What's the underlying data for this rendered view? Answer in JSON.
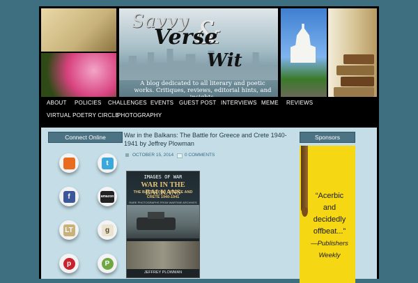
{
  "header": {
    "logo": {
      "line1": "Savvy",
      "line2": "Verse",
      "amp": "&",
      "line3": "Wit"
    },
    "tagline": "A blog dedicated to all literary and poetic works. Critiques, reviews, editorial hints, and insights."
  },
  "nav": {
    "items": [
      "ABOUT",
      "POLICIES",
      "CHALLENGES",
      "EVENTS",
      "GUEST POST",
      "INTERVIEWS",
      "MEME",
      "REVIEWS",
      "VIRTUAL POETRY CIRCLE",
      "PHOTOGRAPHY"
    ]
  },
  "sidebar_left": {
    "title": "Connect Online",
    "icons": [
      {
        "name": "rss-icon",
        "glyph": "",
        "color": "#e86b1f"
      },
      {
        "name": "twitter-icon",
        "glyph": "t",
        "color": "#3aa8db"
      },
      {
        "name": "facebook-icon",
        "glyph": "f",
        "color": "#3b5998"
      },
      {
        "name": "amazon-icon",
        "glyph": "amazon",
        "color": "#222222"
      },
      {
        "name": "librarything-icon",
        "glyph": "LT",
        "color": "#c9b17a"
      },
      {
        "name": "goodreads-icon",
        "glyph": "g",
        "color": "#e9e3cf"
      },
      {
        "name": "pinterest-icon",
        "glyph": "p",
        "color": "#c8232c"
      },
      {
        "name": "posterous-icon",
        "glyph": "P",
        "color": "#6ea842"
      }
    ]
  },
  "post": {
    "title": "War in the Balkans: The Battle for Greece and Crete 1940-1941 by Jeffrey Plowman",
    "date": "OCTOBER 15, 2014",
    "comments": "0 COMMENTS",
    "cover": {
      "series": "IMAGES OF WAR",
      "title_line1": "WAR IN THE BALKANS",
      "title_line2": "THE BATTLE FOR GREECE AND CRETE 1940-1941",
      "subtitle": "RARE PHOTOGRAPHS FROM WARTIME ARCHIVES",
      "author": "JEFFREY PLOWMAN"
    }
  },
  "sidebar_right": {
    "title": "Sponsors",
    "ad": {
      "lines": [
        "“Acerbic",
        "and",
        "decidedly",
        "offbeat...”",
        "—Publishers",
        "Weekly"
      ]
    }
  }
}
